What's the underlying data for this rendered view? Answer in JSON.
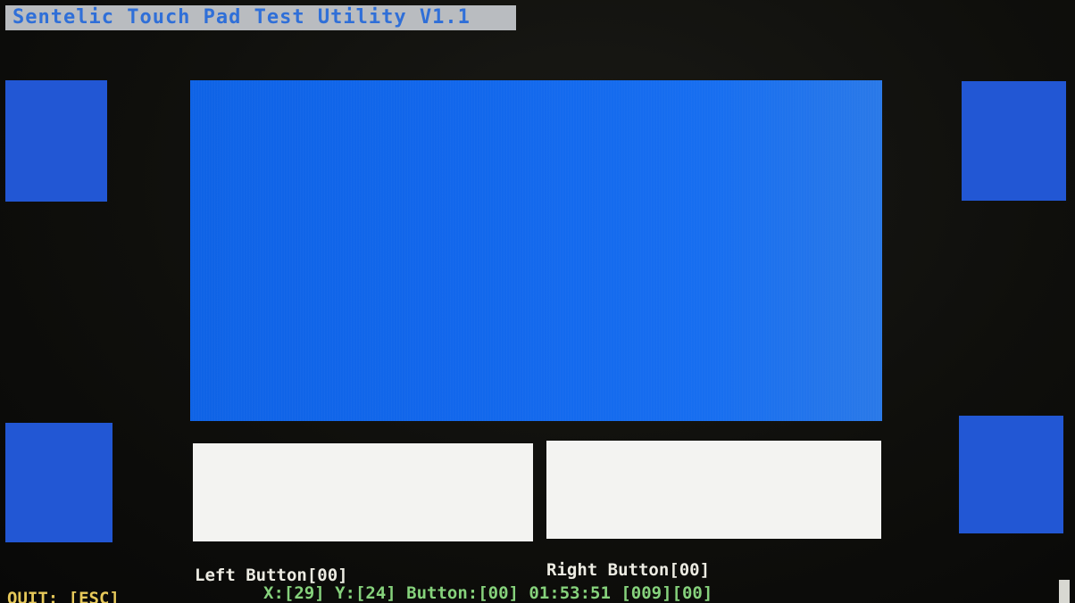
{
  "app": {
    "title": "Sentelic Touch Pad Test Utility V1.1"
  },
  "buttons": {
    "left_label": "Left Button[00]",
    "right_label": "Right Button[00]"
  },
  "status": {
    "quit": "QUIT: [ESC]",
    "readout": "X:[29] Y:[24] Button:[00] 01:53:51 [009][00]"
  },
  "colors": {
    "pad_blue": "#1268ec",
    "corner_blue": "#2257d4",
    "button_white": "#f3f3f1",
    "quit_yellow": "#e7c95a",
    "readout_green": "#86d27c"
  }
}
